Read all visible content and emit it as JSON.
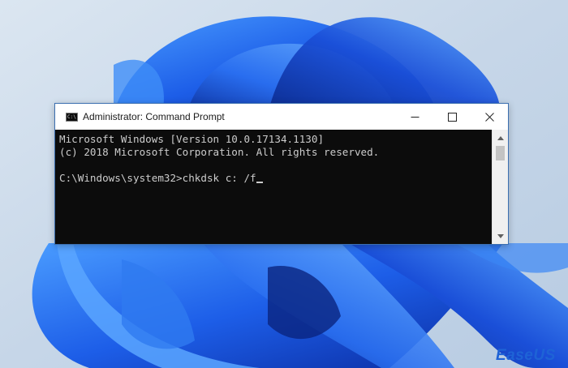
{
  "window": {
    "title": "Administrator: Command Prompt",
    "icon": "cmd-icon",
    "icon_glyph": "C:\\",
    "controls": {
      "minimize": "minimize-icon",
      "maximize": "maximize-icon",
      "close": "close-icon"
    }
  },
  "console": {
    "lines": [
      "Microsoft Windows [Version 10.0.17134.1130]",
      "(c) 2018 Microsoft Corporation. All rights reserved.",
      "",
      "C:\\Windows\\system32>chkdsk c: /f"
    ],
    "background": "#0c0c0c",
    "foreground": "#cccccc"
  },
  "watermark": {
    "text": "EaseUS",
    "color": "#1e63d6"
  },
  "colors": {
    "wallpaper_base": "#c9d7e6",
    "bloom_dark": "#0b2fa8",
    "bloom_light": "#3a8cf5"
  }
}
